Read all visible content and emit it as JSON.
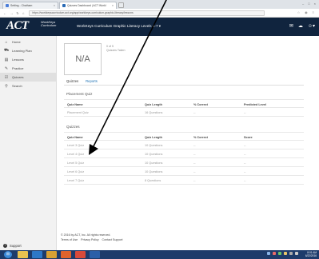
{
  "browser": {
    "tabs": [
      {
        "title": "Setting - Chatham",
        "favicon_color": "#4a7dd9",
        "active": false
      },
      {
        "title": "Quizzes Dashboard | ACT Workl",
        "favicon_color": "#2a6ab5",
        "active": true
      }
    ],
    "url": "https://workkeyscurriculum.act.org/app/workkeys-curriculum-graphic-literacy/lessons"
  },
  "header": {
    "logo_text": "ACT",
    "logo_sub_line1": "WorkKeys",
    "logo_sub_line2": "Curriculum",
    "title": "WorkKeys Curriculum Graphic Literacy Levels 3-7 ▾",
    "icons": [
      "mail-icon",
      "cloud-icon",
      "user-icon"
    ]
  },
  "sidebar": {
    "items": [
      {
        "label": "Home",
        "icon": "home-icon",
        "glyph": "⌂",
        "active": false
      },
      {
        "label": "Learning Plan",
        "icon": "road-icon",
        "glyph": "⛟",
        "active": false
      },
      {
        "label": "Lessons",
        "icon": "book-icon",
        "glyph": "▤",
        "active": false
      },
      {
        "label": "Practice",
        "icon": "pencil-icon",
        "glyph": "✎",
        "active": false
      },
      {
        "label": "Quizzes",
        "icon": "quiz-icon",
        "glyph": "☑",
        "active": true
      },
      {
        "label": "Search",
        "icon": "search-icon",
        "glyph": "⚲",
        "active": false
      }
    ],
    "support_label": "Support"
  },
  "main": {
    "na_value": "N/A",
    "info_line1": "0 of 5",
    "info_line2": "Quizzes Taken",
    "subtabs": [
      {
        "label": "Quizzes",
        "active": true
      },
      {
        "label": "Reports",
        "active": false
      }
    ],
    "placement": {
      "title": "Placement Quiz",
      "headers": [
        "Quiz Name",
        "Quiz Length",
        "% Correct",
        "Predicted Level"
      ],
      "rows": [
        [
          "Placement Quiz",
          "16 Questions",
          "--",
          "--"
        ]
      ]
    },
    "quizzes": {
      "title": "Quizzes",
      "headers": [
        "Quiz Name",
        "Quiz Length",
        "% Correct",
        "Score"
      ],
      "rows": [
        [
          "Level 3 Quiz",
          "10 Questions",
          "--",
          "--"
        ],
        [
          "Level 4 Quiz",
          "10 Questions",
          "--",
          "--"
        ],
        [
          "Level 5 Quiz",
          "10 Questions",
          "--",
          "--"
        ],
        [
          "Level 6 Quiz",
          "10 Questions",
          "--",
          "--"
        ],
        [
          "Level 7 Quiz",
          "8 Questions",
          "--",
          "--"
        ]
      ]
    }
  },
  "footer": {
    "copyright": "© 2016 by ACT, Inc. All rights reserved.",
    "links": [
      "Terms of Use",
      "Privacy Policy",
      "Contact Support"
    ]
  },
  "taskbar": {
    "apps": [
      {
        "name": "explorer-icon",
        "color": "#e8c250"
      },
      {
        "name": "ie-icon",
        "color": "#2d78c8"
      },
      {
        "name": "files-icon",
        "color": "#d9a133"
      },
      {
        "name": "media-icon",
        "color": "#e0632c"
      },
      {
        "name": "chrome-icon",
        "color": "#d84a3a"
      },
      {
        "name": "word-icon",
        "color": "#2b5fa8"
      }
    ],
    "clock_time": "8:01 AM",
    "clock_date": "6/22/2016"
  }
}
